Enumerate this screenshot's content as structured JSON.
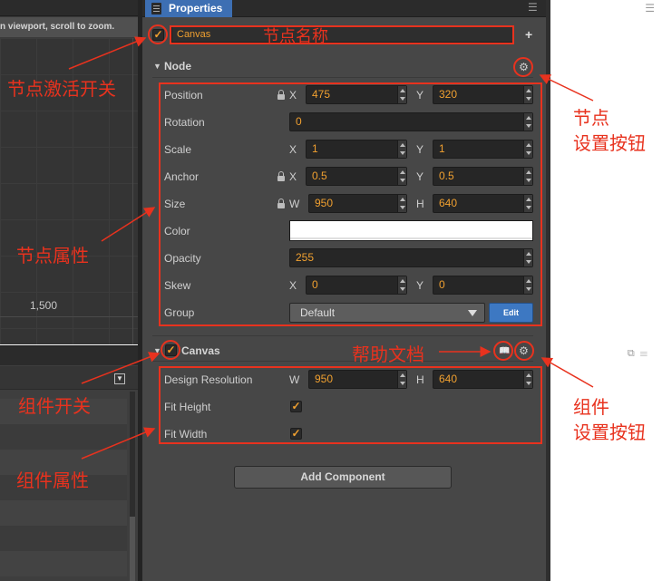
{
  "scene_panel": {
    "menu_icon": "menu-icon",
    "hint": "n viewport, scroll to zoom.",
    "axis_label": "1,500"
  },
  "properties": {
    "tab_label": "Properties",
    "node_name": "Canvas",
    "node_active": true,
    "node_section_title": "Node",
    "node": {
      "position_label": "Position",
      "position_x": "475",
      "position_y": "320",
      "rotation_label": "Rotation",
      "rotation": "0",
      "scale_label": "Scale",
      "scale_x": "1",
      "scale_y": "1",
      "anchor_label": "Anchor",
      "anchor_x": "0.5",
      "anchor_y": "0.5",
      "size_label": "Size",
      "size_w": "950",
      "size_h": "640",
      "color_label": "Color",
      "color_value": "#ffffff",
      "opacity_label": "Opacity",
      "opacity": "255",
      "skew_label": "Skew",
      "skew_x": "0",
      "skew_y": "0",
      "group_label": "Group",
      "group_value": "Default",
      "edit_label": "Edit",
      "axis_x": "X",
      "axis_y": "Y",
      "axis_w": "W",
      "axis_h": "H"
    },
    "component_title": "Canvas",
    "component_enabled": true,
    "component": {
      "design_resolution_label": "Design Resolution",
      "design_w": "950",
      "design_h": "640",
      "fit_height_label": "Fit Height",
      "fit_height": true,
      "fit_width_label": "Fit Width",
      "fit_width": true,
      "axis_w": "W",
      "axis_h": "H"
    },
    "add_component_label": "Add Component"
  },
  "annotations": {
    "node_name": "节点名称",
    "node_active_toggle": "节点激活开关",
    "node_settings_line1": "节点",
    "node_settings_line2": "设置按钮",
    "node_properties": "节点属性",
    "help_docs": "帮助文档",
    "component_toggle": "组件开关",
    "component_settings_line1": "组件",
    "component_settings_line2": "设置按钮",
    "component_properties": "组件属性"
  },
  "colors": {
    "accent_value": "#f0a030",
    "annotation_red": "#e8321e",
    "tab_blue": "#3d6fb3",
    "panel_bg": "#474747"
  }
}
